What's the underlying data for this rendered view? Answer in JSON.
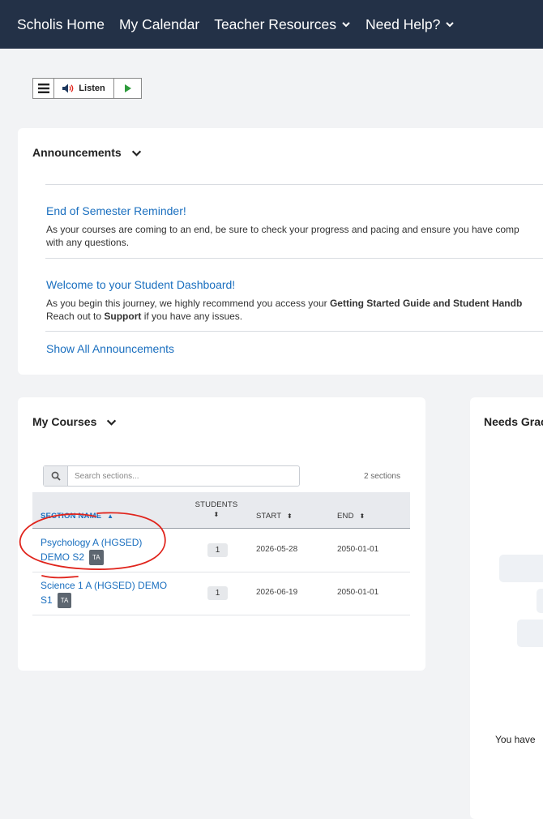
{
  "nav": {
    "items": [
      {
        "label": "Scholis Home",
        "dropdown": false
      },
      {
        "label": "My Calendar",
        "dropdown": false
      },
      {
        "label": "Teacher Resources",
        "dropdown": true
      },
      {
        "label": "Need Help?",
        "dropdown": true
      }
    ]
  },
  "toolbar": {
    "listen_label": "Listen"
  },
  "announcements": {
    "title": "Announcements",
    "items": [
      {
        "title": "End of Semester Reminder!",
        "body_line1": "As your courses are coming to an end, be sure to check your progress and pacing and ensure you have comp",
        "body_line2": "with any questions."
      },
      {
        "title": "Welcome to your Student Dashboard!",
        "body_line1_a": "As you begin this journey, we highly recommend you access your ",
        "body_line1_b": "Getting Started Guide and Student Handb",
        "body_line2_a": "Reach out to ",
        "body_line2_b": "Support",
        "body_line2_c": " if you have any issues."
      }
    ],
    "show_all": "Show All Announcements"
  },
  "courses": {
    "title": "My Courses",
    "search_placeholder": "Search sections...",
    "section_count": "2 sections",
    "headers": {
      "section_name": "SECTION NAME",
      "students": "STUDENTS",
      "start": "START",
      "end": "END"
    },
    "rows": [
      {
        "name_line1": "Psychology A (HGSED)",
        "name_line2": "DEMO S2",
        "badge": "TA",
        "students": "1",
        "start": "2026-05-28",
        "end": "2050-01-01"
      },
      {
        "name_line1": "Science 1 A (HGSED) DEMO",
        "name_line2": "S1",
        "badge": "TA",
        "students": "1",
        "start": "2026-06-19",
        "end": "2050-01-01"
      }
    ]
  },
  "grading": {
    "title": "Needs Grac",
    "message": "You have"
  },
  "colors": {
    "nav_bg": "#233147",
    "link": "#1a6fbf",
    "page_bg": "#f2f3f5",
    "annotation": "#e0241c",
    "play": "#2e9b3c"
  }
}
